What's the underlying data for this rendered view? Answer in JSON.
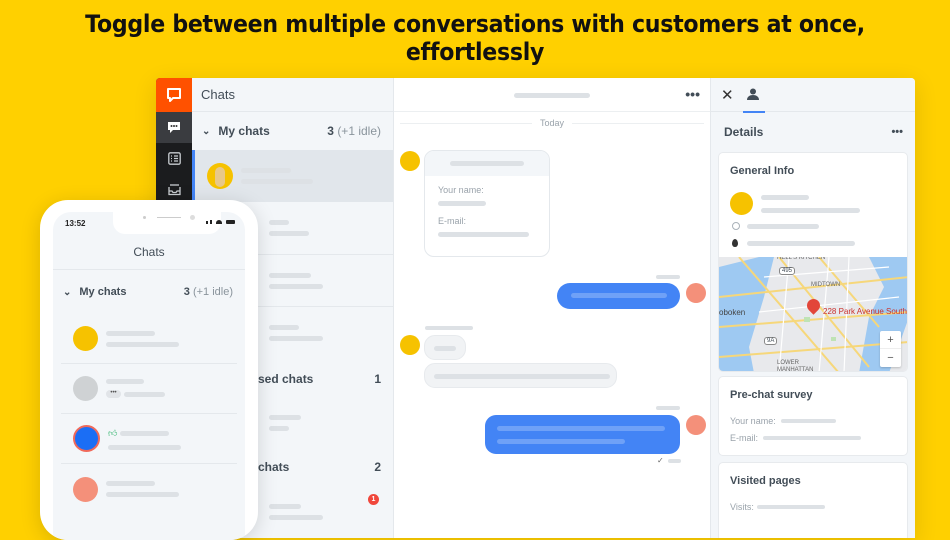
{
  "headline": "Toggle between multiple conversations with customers at once, effortlessly",
  "colors": {
    "background": "#ffd000",
    "brand": "#ff5100",
    "accent": "#4384f5",
    "badge": "#f0473c"
  },
  "app": {
    "rail_icons": [
      "livechat-logo-icon",
      "chats-icon",
      "list-icon",
      "inbox-icon"
    ],
    "list": {
      "title": "Chats",
      "sections": [
        {
          "label": "My chats",
          "count": "3",
          "idle": "(+1 idle)"
        },
        {
          "label": "Supervised chats",
          "visible_label": "sed chats",
          "count": "1"
        },
        {
          "label": "Queued chats",
          "visible_label": "chats",
          "count": "2"
        }
      ],
      "unread_badge": "1"
    },
    "chat": {
      "more_label": "•••",
      "day_separator": "Today",
      "form_card": {
        "name_label": "Your name:",
        "email_label": "E-mail:"
      }
    },
    "details": {
      "title": "Details",
      "more_label": "•••",
      "general_info_title": "General Info",
      "map_label": "228 Park Avenue South",
      "map_places": [
        "HELL'S KITCHEN",
        "MIDTOWN",
        "oboken",
        "LOWER MANHATTAN",
        "495",
        "9A"
      ],
      "zoom_in": "+",
      "zoom_out": "−",
      "prechat_title": "Pre-chat survey",
      "prechat_name": "Your name:",
      "prechat_email": "E-mail:",
      "visited_title": "Visited pages",
      "visits_label": "Visits:"
    }
  },
  "phone": {
    "time": "13:52",
    "title": "Chats",
    "section": {
      "label": "My chats",
      "count": "3",
      "idle": "(+1 idle)"
    }
  }
}
